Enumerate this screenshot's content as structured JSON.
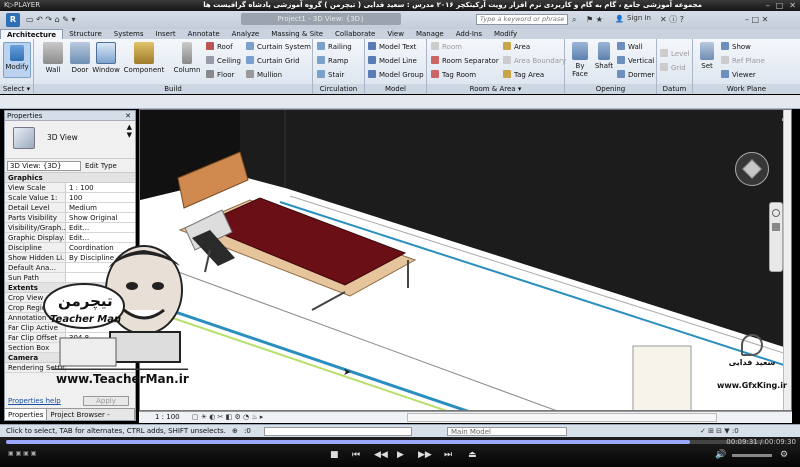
{
  "player": {
    "brand": "K▷PLAYER",
    "title": "مجموعه آموزشی جامع ، گام به گام و کاربردی نرم افزار رویت آرکیتکچر ۲۰۱۶   مدرس : سعید فدایی ( تیچرمن ) گروه آموزشی پادشاه گرافیست ها",
    "time_current": "00:09:31",
    "time_total": "00:09:30"
  },
  "app": {
    "window_tab": "Project1 - 3D View: {3D}",
    "search_placeholder": "Type a keyword or phrase",
    "sign_in": "Sign In"
  },
  "ribbon": {
    "tabs": [
      "Architecture",
      "Structure",
      "Systems",
      "Insert",
      "Annotate",
      "Analyze",
      "Massing & Site",
      "Collaborate",
      "View",
      "Manage",
      "Add-Ins",
      "Modify"
    ],
    "active_tab": "Architecture",
    "select_label": "Select ▾",
    "groups": {
      "build": "Build",
      "circulation": "Circulation",
      "model": "Model",
      "room_area": "Room & Area ▾",
      "opening": "Opening",
      "datum": "Datum",
      "work_plane": "Work Plane"
    },
    "buttons": {
      "modify": "Modify",
      "wall": "Wall",
      "door": "Door",
      "window": "Window",
      "component": "Component",
      "column": "Column",
      "roof": "Roof",
      "ceiling": "Ceiling",
      "floor": "Floor",
      "curtain_system": "Curtain System",
      "curtain_grid": "Curtain Grid",
      "mullion": "Mullion",
      "railing": "Railing",
      "ramp": "Ramp",
      "stair": "Stair",
      "model_text": "Model Text",
      "model_line": "Model Line",
      "model_group": "Model Group",
      "room": "Room",
      "room_separator": "Room Separator",
      "tag_room": "Tag Room",
      "area": "Area",
      "area_boundary": "Area Boundary",
      "tag_area": "Tag Area",
      "by_face": "By Face",
      "shaft": "Shaft",
      "op_wall": "Wall",
      "vertical": "Vertical",
      "dormer": "Dormer",
      "level": "Level",
      "grid": "Grid",
      "set": "Set",
      "show": "Show",
      "ref_plane": "Ref Plane",
      "viewer": "Viewer"
    }
  },
  "properties": {
    "header": "Properties",
    "type_name": "3D View",
    "view_selector": "3D View: {3D}",
    "edit_type": "Edit Type",
    "sections": {
      "graphics": "Graphics",
      "extents": "Extents",
      "camera": "Camera"
    },
    "rows": [
      {
        "k": "View Scale",
        "v": "1 : 100"
      },
      {
        "k": "Scale Value  1:",
        "v": "100"
      },
      {
        "k": "Detail Level",
        "v": "Medium"
      },
      {
        "k": "Parts Visibility",
        "v": "Show Original"
      },
      {
        "k": "Visibility/Graph...",
        "v": "Edit..."
      },
      {
        "k": "Graphic Display...",
        "v": "Edit..."
      },
      {
        "k": "Discipline",
        "v": "Coordination"
      },
      {
        "k": "Show Hidden Li...",
        "v": "By Discipline"
      },
      {
        "k": "Default Ana...",
        "v": ""
      },
      {
        "k": "Sun Path",
        "v": ""
      }
    ],
    "extent_rows": [
      {
        "k": "Crop View",
        "v": ""
      },
      {
        "k": "Crop Region...",
        "v": ""
      },
      {
        "k": "Annotation Cr...",
        "v": ""
      },
      {
        "k": "Far Clip Active",
        "v": ""
      },
      {
        "k": "Far Clip Offset",
        "v": "304.8"
      },
      {
        "k": "Section Box",
        "v": ""
      }
    ],
    "camera_rows": [
      {
        "k": "Rendering Settings",
        "v": ""
      }
    ],
    "help": "Properties help",
    "apply": "Apply",
    "tab_properties": "Properties",
    "tab_browser": "Project Browser - Project1"
  },
  "viewbar": {
    "scale": "1 : 100"
  },
  "status": {
    "message": "Click to select, TAB for alternates, CTRL adds, SHIFT unselects.",
    "zero": ":0",
    "model": "Main Model"
  },
  "overlays": {
    "left_brand": "تیچرمن",
    "left_brand_en": "Teacher Man",
    "left_url": "www.TeacherMan.ir",
    "right_name": "سعید فدایی",
    "right_url": "www.GfxKing.ir"
  },
  "colors": {
    "accent": "#2f6fb3",
    "wall_dark": "#1c1c1c",
    "bed_red": "#6b0f17",
    "headboard": "#d08a50"
  }
}
